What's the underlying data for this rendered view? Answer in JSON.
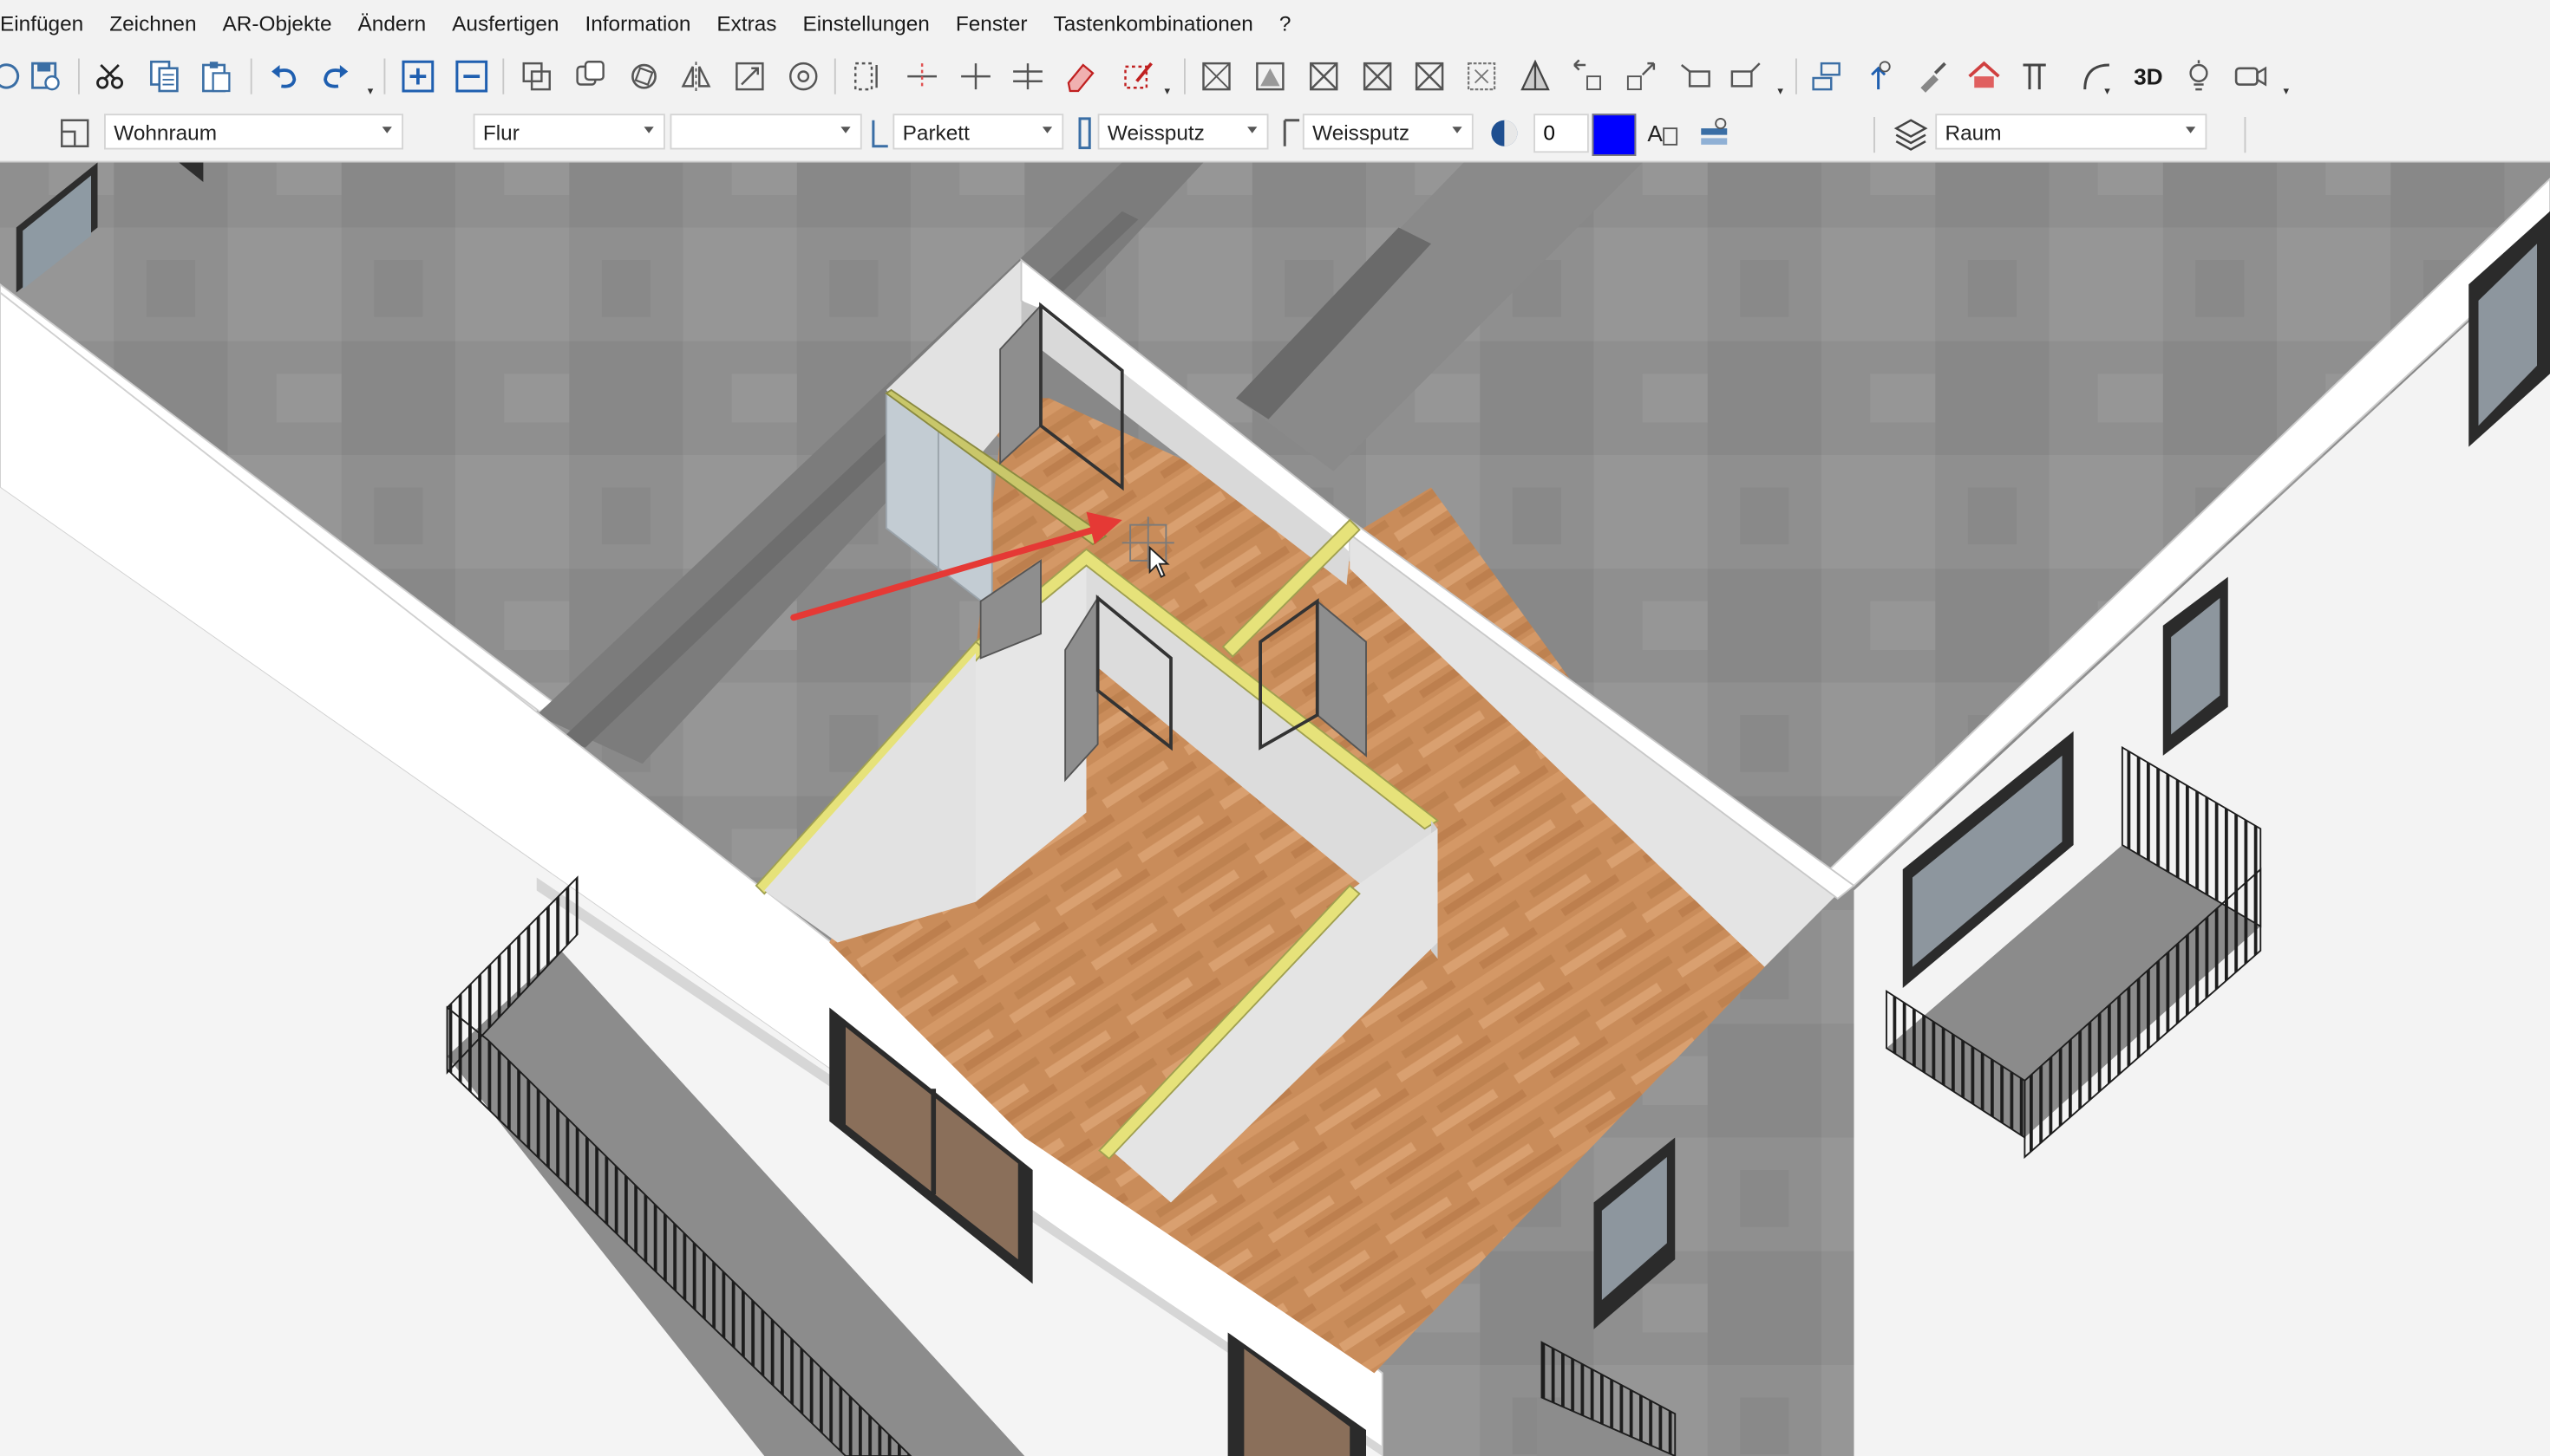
{
  "menu": [
    "Einfügen",
    "Zeichnen",
    "AR-Objekte",
    "Ändern",
    "Ausfertigen",
    "Information",
    "Extras",
    "Einstellungen",
    "Fenster",
    "Tastenkombinationen",
    "?"
  ],
  "toolbar_icons": {
    "undo": "undo-icon",
    "redo": "redo-icon",
    "copy": "copy-icon",
    "paste": "paste-icon",
    "cut": "scissors-icon",
    "save": "save-icon",
    "three_d_label": "3D"
  },
  "properties": {
    "room_function": "Wohnraum",
    "room_name": "Flur",
    "room_extra": "",
    "floor_finish": "Parkett",
    "wall_finish_1": "Weissputz",
    "wall_finish_2": "Weissputz",
    "pen_value": "0",
    "layer": "Raum"
  },
  "colors": {
    "accent_color_box": "#0000ff",
    "annotation_arrow": "#e53935",
    "floor_wood": "#c98c5a",
    "concrete": "#8f8f8f"
  },
  "viewport": {
    "description_icon": "3d-building-model",
    "cursor": "crosshair-cursor-icon"
  }
}
